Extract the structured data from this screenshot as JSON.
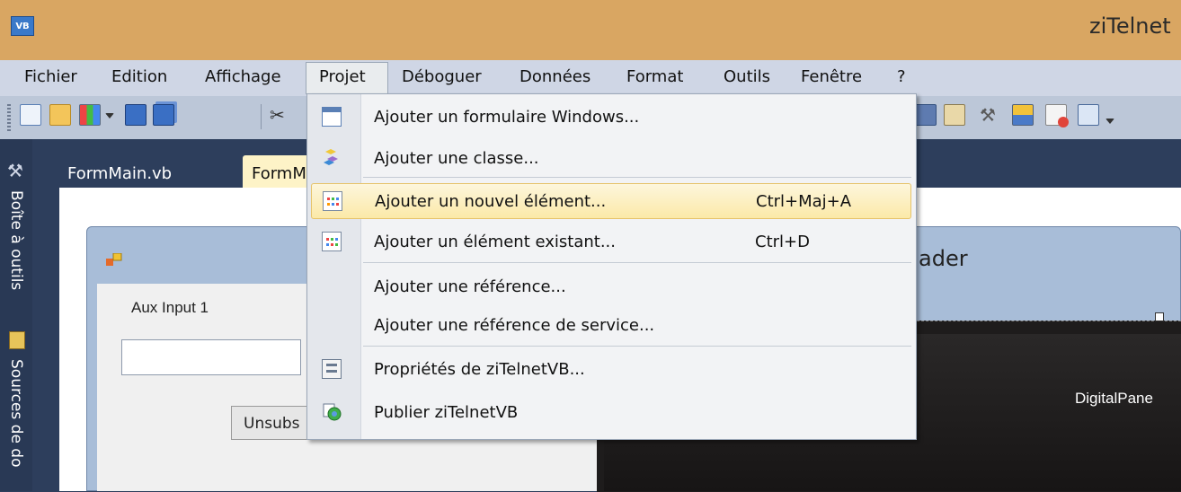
{
  "window": {
    "title": "ziTelnet",
    "app_icon": "VB"
  },
  "menubar": {
    "items": [
      "Fichier",
      "Edition",
      "Affichage",
      "Projet",
      "Déboguer",
      "Données",
      "Format",
      "Outils",
      "Fenêtre",
      "?"
    ],
    "open_menu": "Projet"
  },
  "toolbar": {
    "icons": [
      "new-project-icon",
      "open-folder-icon",
      "add-item-icon",
      "dropdown-arrow-icon",
      "save-icon",
      "save-all-icon",
      "cut-icon",
      "properties-icon",
      "toolbox-icon",
      "object-browser-icon",
      "error-list-icon",
      "output-icon",
      "overflow-icon"
    ]
  },
  "sidebar": {
    "toolbox_label": "Boîte à outils",
    "datasources_label": "Sources de do"
  },
  "tabs": [
    {
      "label": "FormMain.vb",
      "active": false
    },
    {
      "label": "FormM",
      "active": true
    }
  ],
  "form": {
    "title_fragment": "ader",
    "aux_label": "Aux Input 1",
    "unsubscribe_button": "Unsubs",
    "digital_panel_label": "DigitalPane"
  },
  "dropdown": {
    "items": [
      {
        "label": "Ajouter un formulaire Windows...",
        "shortcut": "",
        "icon": "windows-form-icon"
      },
      {
        "label": "Ajouter une classe...",
        "shortcut": "",
        "icon": "class-icon"
      },
      {
        "label": "Ajouter un nouvel élément...",
        "shortcut": "Ctrl+Maj+A",
        "icon": "new-item-icon",
        "highlighted": true
      },
      {
        "label": "Ajouter un élément existant...",
        "shortcut": "Ctrl+D",
        "icon": "existing-item-icon"
      },
      {
        "label": "Ajouter une référence...",
        "shortcut": "",
        "icon": ""
      },
      {
        "label": "Ajouter une référence de service...",
        "shortcut": "",
        "icon": ""
      },
      {
        "label": "Propriétés de ziTelnetVB...",
        "shortcut": "",
        "icon": "project-properties-icon"
      },
      {
        "label": "Publier ziTelnetVB",
        "shortcut": "",
        "icon": "publish-icon"
      }
    ]
  },
  "colors": {
    "titlebar": "#d9a662",
    "menubar": "#cfd6e5",
    "highlight": "#fbe9a8",
    "ide_background": "#2d3e5c"
  }
}
